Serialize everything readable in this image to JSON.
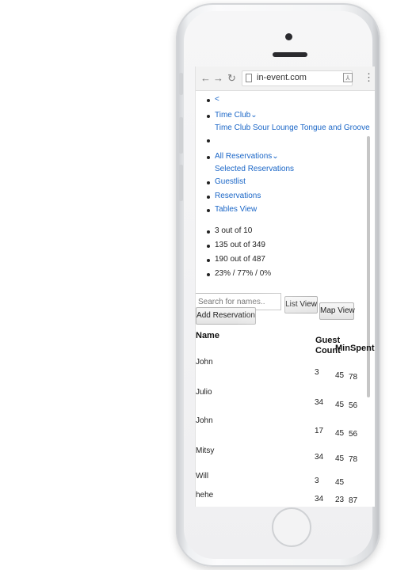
{
  "browser": {
    "back_icon": "back-arrow-icon",
    "forward_icon": "forward-arrow-icon",
    "reload_icon": "reload-icon",
    "url": "in-event.com"
  },
  "nav": {
    "back_link": "<",
    "venue": "Time Club",
    "venue_options": "Time Club Sour Lounge Tongue and Groove",
    "reservations_menu": "All Reservations",
    "selected_reservations": "Selected Reservations",
    "guestlist": "Guestlist",
    "reservations": "Reservations",
    "tables_view": "Tables View",
    "chevron": "⌄"
  },
  "stats": [
    "3 out of 10",
    "135 out of 349",
    "190 out of 487",
    "23% / 77% / 0%"
  ],
  "search": {
    "placeholder": "Search for names.."
  },
  "buttons": {
    "list_view": "List View",
    "map_view": "Map View",
    "add_reservation": "Add Reservation"
  },
  "table": {
    "headers": {
      "name": "Name",
      "guest_count_1": "Guest",
      "guest_count_2": "Count",
      "min_spent": "MinSpent"
    },
    "rows": [
      {
        "name": "John",
        "guests": "3",
        "min": "45",
        "spent": "78"
      },
      {
        "name": "Julio",
        "guests": "34",
        "min": "45",
        "spent": "56"
      },
      {
        "name": "John",
        "guests": "17",
        "min": "45",
        "spent": "56"
      },
      {
        "name": "Mitsy",
        "guests": "34",
        "min": "45",
        "spent": "78"
      },
      {
        "name": "Will",
        "guests": "3",
        "min": "45",
        "spent": ""
      },
      {
        "name": "hehe",
        "guests": "34",
        "min": "23",
        "spent": "87"
      }
    ]
  }
}
